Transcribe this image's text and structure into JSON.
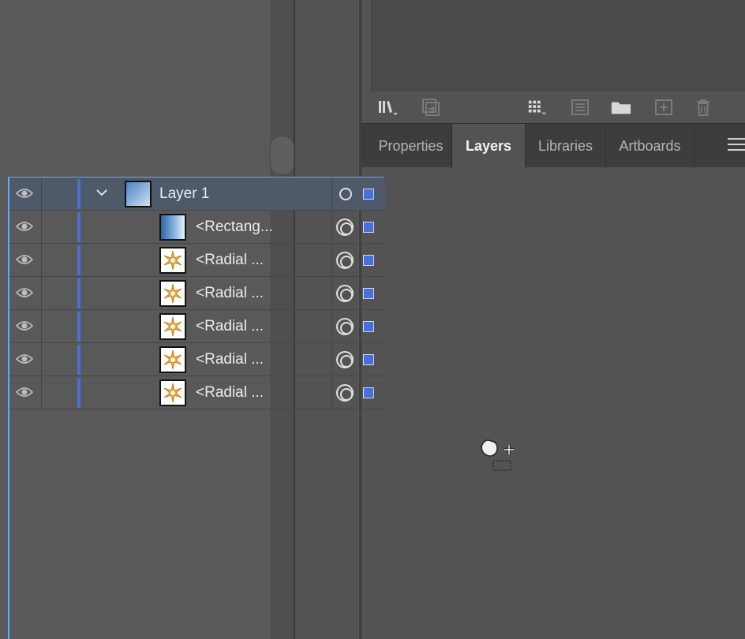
{
  "panel": {
    "tabs": [
      {
        "label": "Properties",
        "active": false
      },
      {
        "label": "Layers",
        "active": true
      },
      {
        "label": "Libraries",
        "active": false
      },
      {
        "label": "Artboards",
        "active": false
      }
    ]
  },
  "toolbar": {
    "icons": [
      "libraries-icon",
      "place-icon",
      "grid-icon",
      "list-icon",
      "folder-icon",
      "new-item-icon",
      "trash-icon"
    ]
  },
  "layers": {
    "parent": {
      "label": "Layer 1",
      "expanded": true
    },
    "items": [
      {
        "label": "<Rectang...",
        "thumb": "gradient"
      },
      {
        "label": "<Radial ...",
        "thumb": "radial"
      },
      {
        "label": "<Radial ...",
        "thumb": "radial"
      },
      {
        "label": "<Radial ...",
        "thumb": "radial"
      },
      {
        "label": "<Radial ...",
        "thumb": "radial"
      },
      {
        "label": "<Radial ...",
        "thumb": "radial"
      }
    ]
  },
  "colors": {
    "layer_color": "#4a6fd6",
    "selection": "#6aa8e8",
    "panel_bg": "#535353",
    "tab_bg": "#3d3d3d"
  }
}
